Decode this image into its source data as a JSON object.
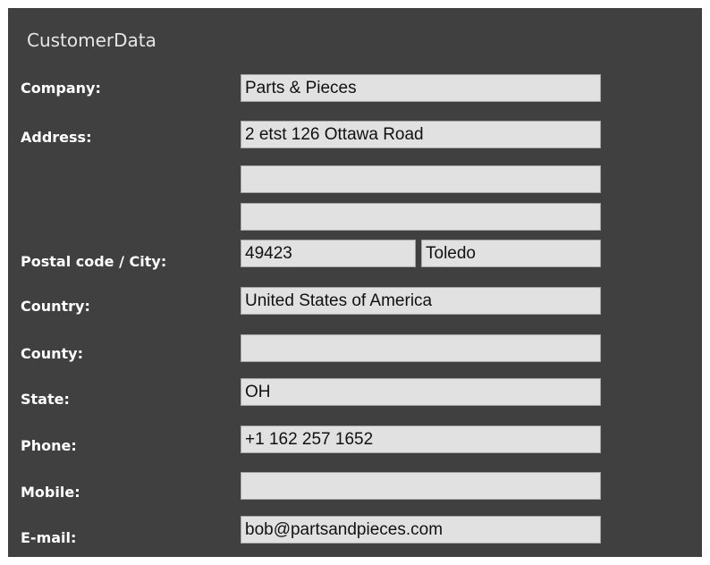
{
  "form": {
    "title": "CustomerData",
    "labels": {
      "company": "Company:",
      "address": "Address:",
      "postal_city": "Postal code / City:",
      "country": "Country:",
      "county": "County:",
      "state": "State:",
      "phone": "Phone:",
      "mobile": "Mobile:",
      "email": "E-mail:"
    },
    "values": {
      "company": "Parts & Pieces",
      "address_line_1": "2 etst 126 Ottawa Road",
      "address_line_2": "",
      "address_line_3": "",
      "postal_code": "49423",
      "city": "Toledo",
      "country": "United States of America",
      "county": "",
      "state": "OH",
      "phone": "+1 162 257 1652",
      "mobile": "",
      "email": "bob@partsandpieces.com"
    }
  },
  "colors": {
    "panel_background": "#404040",
    "field_background": "#e1e1e1",
    "label_text": "#ffffff",
    "title_text": "#e6e6e6"
  }
}
